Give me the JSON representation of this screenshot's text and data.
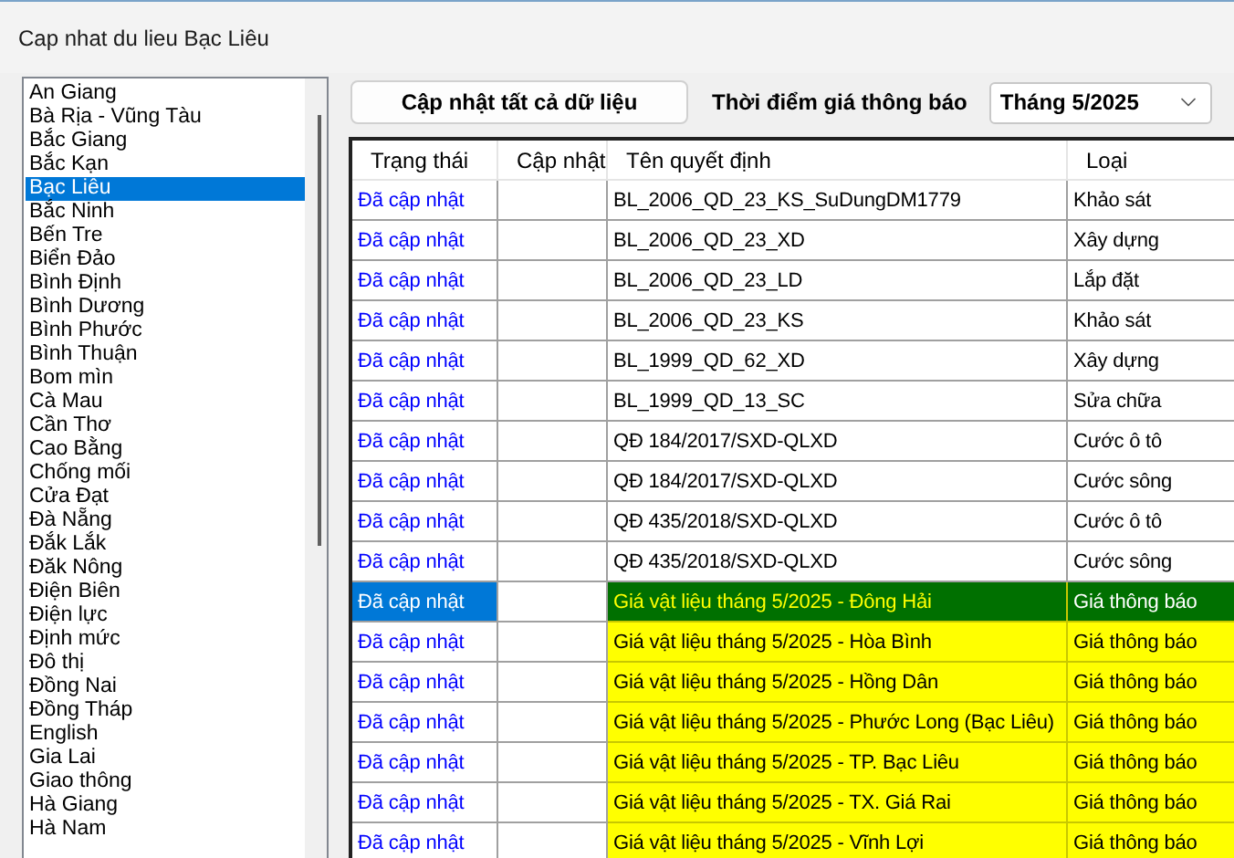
{
  "window": {
    "title": "Cap nhat du lieu Bạc Liêu"
  },
  "provinces": [
    {
      "label": "An Giang",
      "selected": false
    },
    {
      "label": "Bà Rịa - Vũng Tàu",
      "selected": false
    },
    {
      "label": "Bắc Giang",
      "selected": false
    },
    {
      "label": "Bắc Kạn",
      "selected": false
    },
    {
      "label": "Bạc Liêu",
      "selected": true
    },
    {
      "label": "Bắc Ninh",
      "selected": false
    },
    {
      "label": "Bến Tre",
      "selected": false
    },
    {
      "label": "Biển Đảo",
      "selected": false
    },
    {
      "label": "Bình Định",
      "selected": false
    },
    {
      "label": "Bình Dương",
      "selected": false
    },
    {
      "label": "Bình Phước",
      "selected": false
    },
    {
      "label": "Bình Thuận",
      "selected": false
    },
    {
      "label": "Bom mìn",
      "selected": false
    },
    {
      "label": "Cà Mau",
      "selected": false
    },
    {
      "label": "Cần Thơ",
      "selected": false
    },
    {
      "label": "Cao Bằng",
      "selected": false
    },
    {
      "label": "Chống mối",
      "selected": false
    },
    {
      "label": "Cửa Đạt",
      "selected": false
    },
    {
      "label": "Đà Nẵng",
      "selected": false
    },
    {
      "label": "Đắk Lắk",
      "selected": false
    },
    {
      "label": "Đăk Nông",
      "selected": false
    },
    {
      "label": "Điện Biên",
      "selected": false
    },
    {
      "label": "Điện lực",
      "selected": false
    },
    {
      "label": "Định mức",
      "selected": false
    },
    {
      "label": "Đô thị",
      "selected": false
    },
    {
      "label": "Đồng Nai",
      "selected": false
    },
    {
      "label": "Đồng Tháp",
      "selected": false
    },
    {
      "label": "English",
      "selected": false
    },
    {
      "label": "Gia Lai",
      "selected": false
    },
    {
      "label": "Giao thông",
      "selected": false
    },
    {
      "label": "Hà Giang",
      "selected": false
    },
    {
      "label": "Hà Nam",
      "selected": false
    }
  ],
  "update_all_button": "Cập nhật tất cả dữ liệu",
  "period": {
    "label": "Thời điểm giá thông báo",
    "value": "Tháng 5/2025"
  },
  "table": {
    "columns": [
      "Trạng thái",
      "Cập nhật",
      "Tên quyết định",
      "Loại"
    ],
    "rows": [
      {
        "status": "Đã cập nhật",
        "name": "BL_2006_QD_23_KS_SuDungDM1779",
        "type": "Khảo sát",
        "highlighted": false,
        "selected": false
      },
      {
        "status": "Đã cập nhật",
        "name": "BL_2006_QD_23_XD",
        "type": "Xây dựng",
        "highlighted": false,
        "selected": false
      },
      {
        "status": "Đã cập nhật",
        "name": "BL_2006_QD_23_LD",
        "type": "Lắp đặt",
        "highlighted": false,
        "selected": false
      },
      {
        "status": "Đã cập nhật",
        "name": "BL_2006_QD_23_KS",
        "type": "Khảo sát",
        "highlighted": false,
        "selected": false
      },
      {
        "status": "Đã cập nhật",
        "name": "BL_1999_QD_62_XD",
        "type": "Xây dựng",
        "highlighted": false,
        "selected": false
      },
      {
        "status": "Đã cập nhật",
        "name": "BL_1999_QD_13_SC",
        "type": "Sửa chữa",
        "highlighted": false,
        "selected": false
      },
      {
        "status": "Đã cập nhật",
        "name": "QĐ 184/2017/SXD-QLXD",
        "type": "Cước ô tô",
        "highlighted": false,
        "selected": false
      },
      {
        "status": "Đã cập nhật",
        "name": "QĐ 184/2017/SXD-QLXD",
        "type": "Cước sông",
        "highlighted": false,
        "selected": false
      },
      {
        "status": "Đã cập nhật",
        "name": "QĐ 435/2018/SXD-QLXD",
        "type": "Cước ô tô",
        "highlighted": false,
        "selected": false
      },
      {
        "status": "Đã cập nhật",
        "name": "QĐ 435/2018/SXD-QLXD",
        "type": "Cước sông",
        "highlighted": false,
        "selected": false
      },
      {
        "status": "Đã cập nhật",
        "name": "Giá vật liệu tháng 5/2025 - Đông Hải",
        "type": "Giá thông báo",
        "highlighted": true,
        "selected": true
      },
      {
        "status": "Đã cập nhật",
        "name": "Giá vật liệu tháng 5/2025 - Hòa Bình",
        "type": "Giá thông báo",
        "highlighted": true,
        "selected": false
      },
      {
        "status": "Đã cập nhật",
        "name": "Giá vật liệu tháng 5/2025 - Hồng Dân",
        "type": "Giá thông báo",
        "highlighted": true,
        "selected": false
      },
      {
        "status": "Đã cập nhật",
        "name": "Giá vật liệu tháng 5/2025 - Phước Long (Bạc Liêu)",
        "type": "Giá thông báo",
        "highlighted": true,
        "selected": false
      },
      {
        "status": "Đã cập nhật",
        "name": "Giá vật liệu tháng 5/2025 - TP. Bạc Liêu",
        "type": "Giá thông báo",
        "highlighted": true,
        "selected": false
      },
      {
        "status": "Đã cập nhật",
        "name": "Giá vật liệu tháng 5/2025 - TX. Giá Rai",
        "type": "Giá thông báo",
        "highlighted": true,
        "selected": false
      },
      {
        "status": "Đã cập nhật",
        "name": "Giá vật liệu tháng 5/2025 - Vĩnh Lợi",
        "type": "Giá thông báo",
        "highlighted": true,
        "selected": false
      }
    ]
  }
}
